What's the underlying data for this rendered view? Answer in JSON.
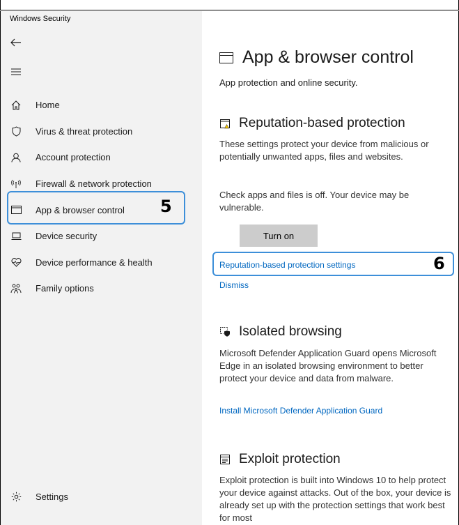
{
  "window": {
    "title": "Windows Security"
  },
  "sidebar": {
    "items": [
      {
        "label": "Home",
        "icon": "home-icon"
      },
      {
        "label": "Virus & threat protection",
        "icon": "shield-icon"
      },
      {
        "label": "Account protection",
        "icon": "person-icon"
      },
      {
        "label": "Firewall & network protection",
        "icon": "wifi-antenna-icon"
      },
      {
        "label": "App & browser control",
        "icon": "browser-window-icon"
      },
      {
        "label": "Device security",
        "icon": "laptop-icon"
      },
      {
        "label": "Device performance & health",
        "icon": "heart-icon"
      },
      {
        "label": "Family options",
        "icon": "family-icon"
      }
    ],
    "active_index": 4,
    "settings_label": "Settings"
  },
  "annotations": {
    "step5": "5",
    "step6": "6"
  },
  "main": {
    "title": "App & browser control",
    "subtitle": "App protection and online security.",
    "reputation": {
      "title": "Reputation-based protection",
      "desc": "These settings protect your device from malicious or potentially unwanted apps, files and websites.",
      "warning": "Check apps and files is off. Your device may be vulnerable.",
      "button": "Turn on",
      "settings_link": "Reputation-based protection settings",
      "dismiss_link": "Dismiss"
    },
    "isolated": {
      "title": "Isolated browsing",
      "desc": "Microsoft Defender Application Guard opens Microsoft Edge in an isolated browsing environment to better protect your device and data from malware.",
      "link": "Install Microsoft Defender Application Guard"
    },
    "exploit": {
      "title": "Exploit protection",
      "desc": "Exploit protection is built into Windows 10 to help protect your device against attacks.  Out of the box, your device is already set up with the protection settings that work best for most"
    }
  },
  "colors": {
    "accent": "#0067c0",
    "highlight": "#3d8fd9",
    "sidebar_bg": "#f2f2f2",
    "button_bg": "#cccccc"
  }
}
